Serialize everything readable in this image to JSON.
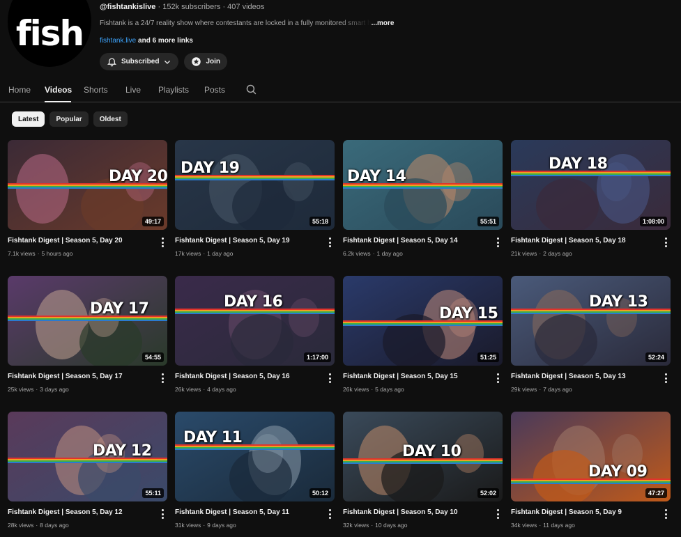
{
  "channel": {
    "avatar_text": "fish",
    "handle": "@fishtankislive",
    "subscribers": "152k subscribers",
    "videos_count": "407 videos",
    "separator": "·",
    "description": "Fishtank is a 24/7 reality show where contestants are locked in a fully monitored smart h",
    "more": "...more",
    "link": "fishtank.live",
    "more_links": "and 6 more links",
    "subscribed_label": "Subscribed",
    "join_label": "Join"
  },
  "tabs": [
    {
      "label": "Home"
    },
    {
      "label": "Videos"
    },
    {
      "label": "Shorts"
    },
    {
      "label": "Live"
    },
    {
      "label": "Playlists"
    },
    {
      "label": "Posts"
    }
  ],
  "filters": [
    {
      "label": "Latest"
    },
    {
      "label": "Popular"
    },
    {
      "label": "Oldest"
    }
  ],
  "videos": [
    {
      "title": "Fishtank Digest | Season 5, Day 20",
      "views": "7.1k views",
      "age": "5 hours ago",
      "duration": "49:17",
      "badge": "DAY 20",
      "colors": [
        "#3b2a36",
        "#b86a86",
        "#6a3a2a"
      ]
    },
    {
      "title": "Fishtank Digest | Season 5, Day 19",
      "views": "17k views",
      "age": "1 day ago",
      "duration": "55:18",
      "badge": "DAY 19",
      "colors": [
        "#283648",
        "#4a5a6a",
        "#1e2a3a"
      ]
    },
    {
      "title": "Fishtank Digest | Season 5, Day 14",
      "views": "6.2k views",
      "age": "1 day ago",
      "duration": "55:51",
      "badge": "DAY 14",
      "colors": [
        "#3a6a7a",
        "#c08a6a",
        "#2a4a5a"
      ]
    },
    {
      "title": "Fishtank Digest | Season 5, Day 18",
      "views": "21k views",
      "age": "2 days ago",
      "duration": "1:08:00",
      "badge": "DAY 18",
      "colors": [
        "#2a3a5a",
        "#4a5a8a",
        "#3a2a3a"
      ]
    },
    {
      "title": "Fishtank Digest | Season 5, Day 17",
      "views": "25k views",
      "age": "3 days ago",
      "duration": "54:55",
      "badge": "DAY 17",
      "colors": [
        "#5a3a6a",
        "#c0a090",
        "#2a3a2a"
      ]
    },
    {
      "title": "Fishtank Digest | Season 5, Day 16",
      "views": "26k views",
      "age": "4 days ago",
      "duration": "1:17:00",
      "badge": "DAY 16",
      "colors": [
        "#3a2a4a",
        "#6a4a6a",
        "#2a2a3a"
      ]
    },
    {
      "title": "Fishtank Digest | Season 5, Day 15",
      "views": "26k views",
      "age": "5 days ago",
      "duration": "51:25",
      "badge": "DAY 15",
      "colors": [
        "#2a3a6a",
        "#c08a7a",
        "#1a1a2a"
      ]
    },
    {
      "title": "Fishtank Digest | Season 5, Day 13",
      "views": "29k views",
      "age": "7 days ago",
      "duration": "52:24",
      "badge": "DAY 13",
      "colors": [
        "#4a5a7a",
        "#8a6a5a",
        "#2a2a3a"
      ]
    },
    {
      "title": "Fishtank Digest | Season 5, Day 12",
      "views": "28k views",
      "age": "8 days ago",
      "duration": "55:11",
      "badge": "DAY 12",
      "colors": [
        "#5a3a5a",
        "#c09080",
        "#3a4a6a"
      ]
    },
    {
      "title": "Fishtank Digest | Season 5, Day 11",
      "views": "31k views",
      "age": "9 days ago",
      "duration": "50:12",
      "badge": "DAY 11",
      "colors": [
        "#2a4a6a",
        "#8a9aaa",
        "#1a2a3a"
      ]
    },
    {
      "title": "Fishtank Digest | Season 5, Day 10",
      "views": "32k views",
      "age": "10 days ago",
      "duration": "52:02",
      "badge": "DAY 10",
      "colors": [
        "#3a4a5a",
        "#c08a6a",
        "#1a1a1a"
      ]
    },
    {
      "title": "Fishtank Digest | Season 5, Day 9",
      "views": "34k views",
      "age": "11 days ago",
      "duration": "47:27",
      "badge": "DAY 09",
      "colors": [
        "#4a3a5a",
        "#a07a6a",
        "#c05a1a"
      ]
    }
  ]
}
